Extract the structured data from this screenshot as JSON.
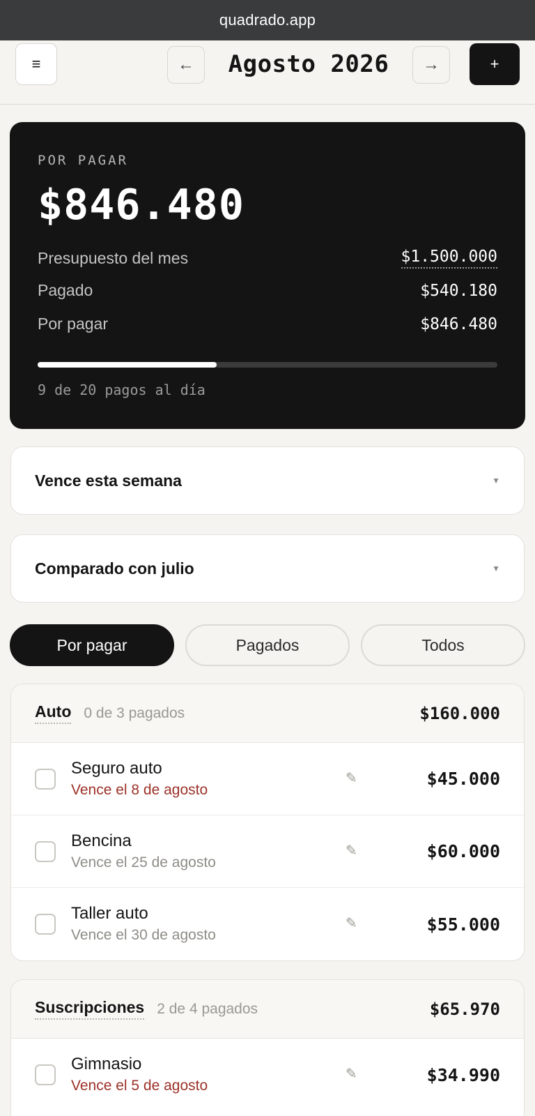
{
  "browser": {
    "url": "quadrado.app"
  },
  "header": {
    "menu_icon": "≡",
    "prev_icon": "←",
    "month": "Agosto 2026",
    "next_icon": "→",
    "add_icon": "+"
  },
  "summary": {
    "label": "POR PAGAR",
    "amount": "$846.480",
    "rows": [
      {
        "label": "Presupuesto del mes",
        "value": "$1.500.000"
      },
      {
        "label": "Pagado",
        "value": "$540.180"
      },
      {
        "label": "Por pagar",
        "value": "$846.480"
      }
    ],
    "progress_fraction": 0.39,
    "footer": "9 de 20 pagos al día"
  },
  "sections": [
    {
      "title": "Vence esta semana",
      "chevron": "▼"
    },
    {
      "title": "Comparado con julio",
      "chevron": "▼"
    }
  ],
  "tabs": [
    {
      "label": "Por pagar",
      "active": true
    },
    {
      "label": "Pagados",
      "active": false
    },
    {
      "label": "Todos",
      "active": false
    }
  ],
  "groups": [
    {
      "name": "Auto",
      "count": "0 de 3 pagados",
      "total": "$160.000",
      "items": [
        {
          "name": "Seguro auto",
          "due": "Vence el 8 de agosto",
          "urgent": true,
          "amount": "$45.000"
        },
        {
          "name": "Bencina",
          "due": "Vence el 25 de agosto",
          "urgent": false,
          "amount": "$60.000"
        },
        {
          "name": "Taller auto",
          "due": "Vence el 30 de agosto",
          "urgent": false,
          "amount": "$55.000"
        }
      ]
    },
    {
      "name": "Suscripciones",
      "count": "2 de 4 pagados",
      "total": "$65.970",
      "items": [
        {
          "name": "Gimnasio",
          "due": "Vence el 5 de agosto",
          "urgent": true,
          "amount": "$34.990"
        }
      ]
    }
  ],
  "edit_icon": "✎",
  "colors": {
    "background": "#f5f4f0",
    "dark": "#141414",
    "urgent": "#9b3128"
  }
}
